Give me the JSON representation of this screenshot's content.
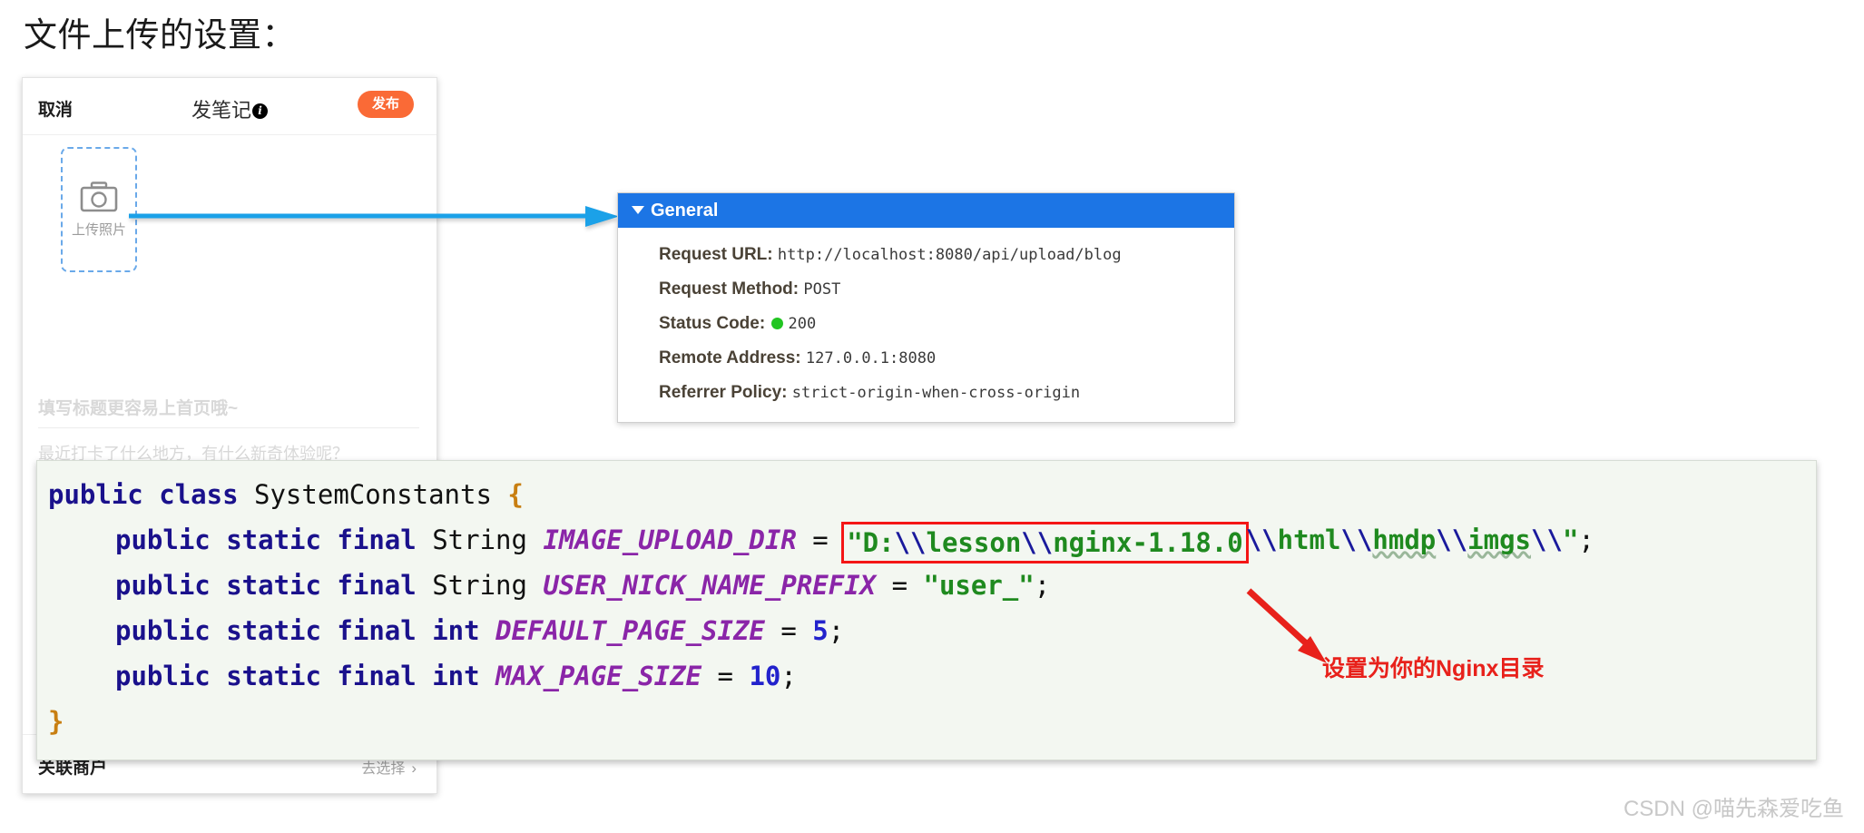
{
  "page": {
    "heading": "文件上传的设置：",
    "watermark": "CSDN @喵先森爱吃鱼"
  },
  "composer": {
    "cancel_label": "取消",
    "title": "发笔记",
    "info_badge": "i",
    "publish_label": "发布",
    "upload": {
      "icon": "camera-icon",
      "label": "上传照片"
    },
    "title_placeholder": "填写标题更容易上首页哦~",
    "body_placeholder": "最近打卡了什么地方，有什么新奇体验呢？",
    "footer": {
      "label": "关联商户",
      "action": "去选择",
      "chevron": "›"
    }
  },
  "general_panel": {
    "header": "General",
    "rows": [
      {
        "key": "Request URL:",
        "value": "http://localhost:8080/api/upload/blog",
        "has_status_dot": false
      },
      {
        "key": "Request Method:",
        "value": "POST",
        "has_status_dot": false
      },
      {
        "key": "Status Code:",
        "value": "200",
        "has_status_dot": true
      },
      {
        "key": "Remote Address:",
        "value": "127.0.0.1:8080",
        "has_status_dot": false
      },
      {
        "key": "Referrer Policy:",
        "value": "strict-origin-when-cross-origin",
        "has_status_dot": false
      }
    ],
    "status_color": "#22c522",
    "header_color": "#1c75e5"
  },
  "code": {
    "class_decl": {
      "kw1": "public",
      "kw2": "class",
      "name": "SystemConstants",
      "brace": "{"
    },
    "line_image_upload": {
      "modifiers": "public static final",
      "type": "String",
      "const": "IMAGE_UPLOAD_DIR",
      "eq": "=",
      "boxed_string": "\"D:\\\\lesson\\\\nginx-1.18.0",
      "boxed_parts": [
        "\"D:",
        "\\\\",
        "lesson",
        "\\\\",
        "nginx-1.18.0"
      ],
      "tail_parts": [
        "\\\\",
        "html",
        "\\\\",
        "hmdp",
        "\\\\",
        "imgs",
        "\\\\",
        "\""
      ],
      "semi": ";"
    },
    "line_nick_prefix": {
      "modifiers": "public static final",
      "type": "String",
      "const": "USER_NICK_NAME_PREFIX",
      "eq": "=",
      "value": "\"user_\"",
      "semi": ";"
    },
    "line_default_page": {
      "modifiers": "public static final",
      "type": "int",
      "const": "DEFAULT_PAGE_SIZE",
      "eq": "=",
      "value": "5",
      "semi": ";"
    },
    "line_max_page": {
      "modifiers": "public static final",
      "type": "int",
      "const": "MAX_PAGE_SIZE",
      "eq": "=",
      "value": "10",
      "semi": ";"
    },
    "close_brace": "}"
  },
  "annotation": {
    "text": "设置为你的Nginx目录",
    "color": "#e8211b"
  },
  "arrows": {
    "connector_color": "#1ba1e8",
    "annotation_color": "#e8211b"
  }
}
